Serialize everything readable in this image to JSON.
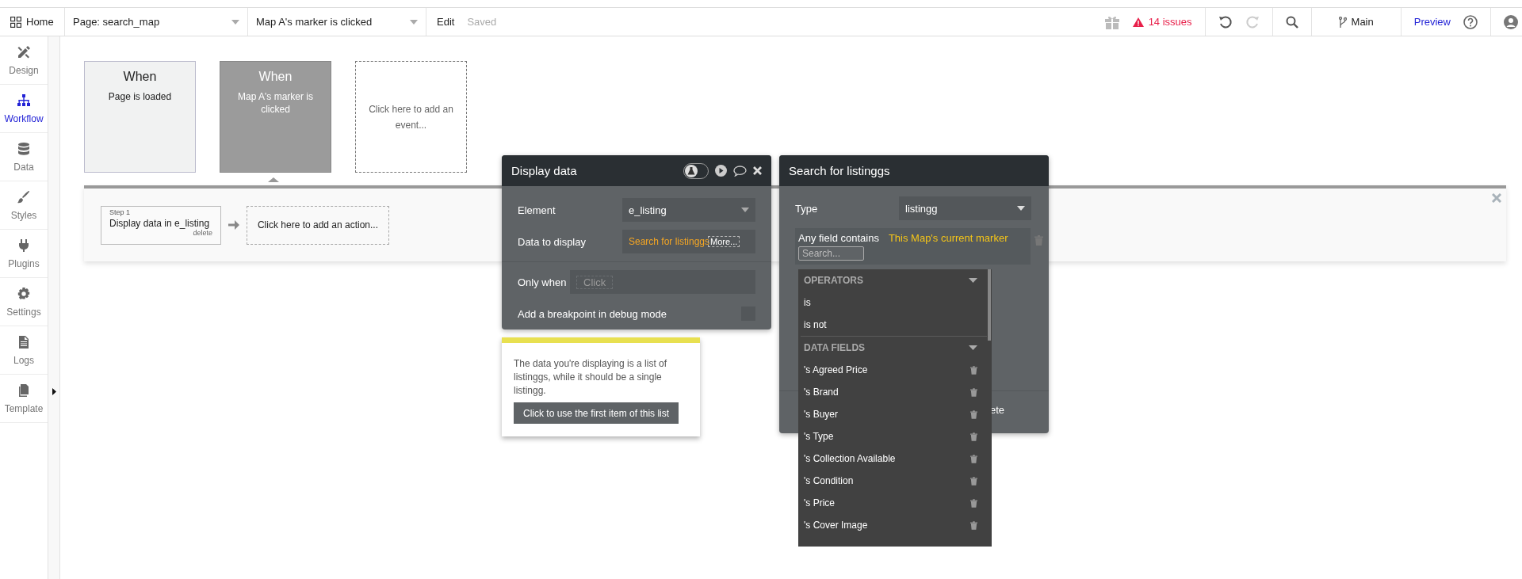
{
  "topbar": {
    "home": "Home",
    "page_select": "Page: search_map",
    "event_select": "Map A's marker is clicked",
    "edit": "Edit",
    "status": "Saved",
    "issues": "14 issues",
    "undo": {
      "disabled": false
    },
    "redo": {
      "disabled": true
    },
    "branch": "Main",
    "preview": "Preview"
  },
  "sidebar": {
    "items": [
      {
        "label": "Design",
        "selected": false
      },
      {
        "label": "Workflow",
        "selected": true
      },
      {
        "label": "Data",
        "selected": false
      },
      {
        "label": "Styles",
        "selected": false
      },
      {
        "label": "Plugins",
        "selected": false
      },
      {
        "label": "Settings",
        "selected": false
      },
      {
        "label": "Logs",
        "selected": false
      },
      {
        "label": "Template",
        "selected": false
      }
    ]
  },
  "events": [
    {
      "kind": "event",
      "title": "When",
      "label": "Page is loaded",
      "selected": false
    },
    {
      "kind": "event",
      "title": "When",
      "label": "Map A's marker is clicked",
      "selected": true
    },
    {
      "kind": "add",
      "label": "Click here to add an event..."
    }
  ],
  "actions": {
    "steps": [
      {
        "step": "Step 1",
        "label": "Display data in e_listing",
        "delete": "delete"
      }
    ],
    "add": "Click here to add an action..."
  },
  "display_panel": {
    "title": "Display data",
    "debug_toggle": {
      "on": false
    },
    "element_label": "Element",
    "element_value": "e_listing",
    "data_label": "Data to display",
    "data_value": "Search for listinggs",
    "data_more": "More...",
    "only_when_label": "Only when",
    "only_when_placeholder": "Click",
    "breakpoint_label": "Add a breakpoint in debug mode",
    "breakpoint_checked": false
  },
  "warning": {
    "text": "The data you're displaying is a list of listinggs, while it should be a single listingg.",
    "button": "Click to use the first item of this list"
  },
  "search_panel": {
    "title": "Search for listinggs",
    "type_label": "Type",
    "type_value": "listingg",
    "constraint_label": "Any field contains",
    "constraint_value": "This Map's current marker",
    "search_placeholder": "Search...",
    "hidden_button": "ete"
  },
  "dropdown": {
    "sections": [
      {
        "title": "OPERATORS",
        "items": [
          {
            "kind": "operator",
            "label": "is"
          },
          {
            "kind": "operator",
            "label": "is not"
          }
        ]
      },
      {
        "title": "DATA FIELDS",
        "items": [
          {
            "kind": "field",
            "label": "'s Agreed Price"
          },
          {
            "kind": "field",
            "label": "'s Brand"
          },
          {
            "kind": "field",
            "label": "'s Buyer"
          },
          {
            "kind": "field",
            "label": "'s Type"
          },
          {
            "kind": "field",
            "label": "'s Collection Available"
          },
          {
            "kind": "field",
            "label": "'s Condition"
          },
          {
            "kind": "field",
            "label": "'s Price"
          },
          {
            "kind": "field",
            "label": "'s Cover Image"
          }
        ]
      }
    ]
  }
}
